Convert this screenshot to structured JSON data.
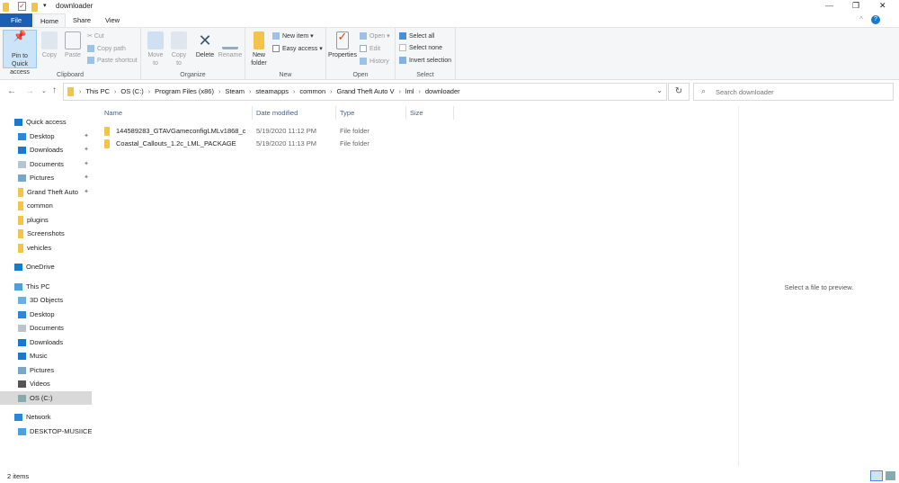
{
  "window": {
    "title": "downloader",
    "minimize": "—",
    "maximize": "❐",
    "close": "✕",
    "help": "?"
  },
  "tabs": [
    "File",
    "Home",
    "Share",
    "View"
  ],
  "ribbon": {
    "clipboard": {
      "label": "Clipboard",
      "pin": "Pin to Quick access",
      "copy": "Copy",
      "paste": "Paste",
      "cut": "Cut",
      "copy_path": "Copy path",
      "paste_shortcut": "Paste shortcut"
    },
    "organize": {
      "label": "Organize",
      "move_to": "Move to",
      "copy_to": "Copy to",
      "delete": "Delete",
      "rename": "Rename"
    },
    "new": {
      "label": "New",
      "new_folder": "New folder",
      "new_item": "New item ▾",
      "easy_access": "Easy access ▾"
    },
    "open": {
      "label": "Open",
      "properties": "Properties",
      "open": "Open ▾",
      "edit": "Edit",
      "history": "History"
    },
    "select": {
      "label": "Select",
      "select_all": "Select all",
      "select_none": "Select none",
      "invert": "Invert selection"
    }
  },
  "address": {
    "path": [
      "This PC",
      "OS (C:)",
      "Program Files (x86)",
      "Steam",
      "steamapps",
      "common",
      "Grand Theft Auto V",
      "lml",
      "downloader"
    ]
  },
  "search": {
    "placeholder": "Search downloader"
  },
  "columns": [
    "Name",
    "Date modified",
    "Type",
    "Size"
  ],
  "files": [
    {
      "name": "144589283_GTAVGameconfigLMLv1868_c",
      "date": "5/19/2020 11:12 PM",
      "type": "File folder",
      "size": ""
    },
    {
      "name": "Coastal_Callouts_1.2c_LML_PACKAGE",
      "date": "5/19/2020 11:13 PM",
      "type": "File folder",
      "size": ""
    }
  ],
  "nav": [
    {
      "label": "Quick access",
      "icon": "star-icon",
      "level": 0
    },
    {
      "label": "Desktop",
      "icon": "desktop-icon",
      "level": 1,
      "pinned": true
    },
    {
      "label": "Downloads",
      "icon": "download-icon",
      "level": 1,
      "pinned": true
    },
    {
      "label": "Documents",
      "icon": "documents-icon",
      "level": 1,
      "pinned": true
    },
    {
      "label": "Pictures",
      "icon": "pictures-icon",
      "level": 1,
      "pinned": true
    },
    {
      "label": "Grand Theft Auto",
      "icon": "folder-icon",
      "level": 1,
      "pinned": true
    },
    {
      "label": "common",
      "icon": "folder-icon",
      "level": 1
    },
    {
      "label": "plugins",
      "icon": "folder-icon",
      "level": 1
    },
    {
      "label": "Screenshots",
      "icon": "folder-icon",
      "level": 1
    },
    {
      "label": "vehicles",
      "icon": "folder-icon",
      "level": 1
    },
    {
      "label": "OneDrive",
      "icon": "cloud-icon",
      "level": 0,
      "gap": true
    },
    {
      "label": "This PC",
      "icon": "computer-icon",
      "level": 0,
      "gap": true
    },
    {
      "label": "3D Objects",
      "icon": "cube-icon",
      "level": 1
    },
    {
      "label": "Desktop",
      "icon": "desktop-icon",
      "level": 1
    },
    {
      "label": "Documents",
      "icon": "documents-icon",
      "level": 1
    },
    {
      "label": "Downloads",
      "icon": "download-icon",
      "level": 1
    },
    {
      "label": "Music",
      "icon": "music-icon",
      "level": 1
    },
    {
      "label": "Pictures",
      "icon": "pictures-icon",
      "level": 1
    },
    {
      "label": "Videos",
      "icon": "video-icon",
      "level": 1
    },
    {
      "label": "OS (C:)",
      "icon": "drive-icon",
      "level": 1,
      "selected": true
    },
    {
      "label": "Network",
      "icon": "network-icon",
      "level": 0,
      "gap": true
    },
    {
      "label": "DESKTOP-MUSIICE",
      "icon": "computer-icon",
      "level": 1
    }
  ],
  "preview": {
    "message": "Select a file to preview."
  },
  "status": {
    "count": "2 items"
  },
  "colors": {
    "accent": "#1979ca",
    "file_tab": "#1a5fb4",
    "selected": "#d9d9d9",
    "folder": "#f4c34a"
  }
}
